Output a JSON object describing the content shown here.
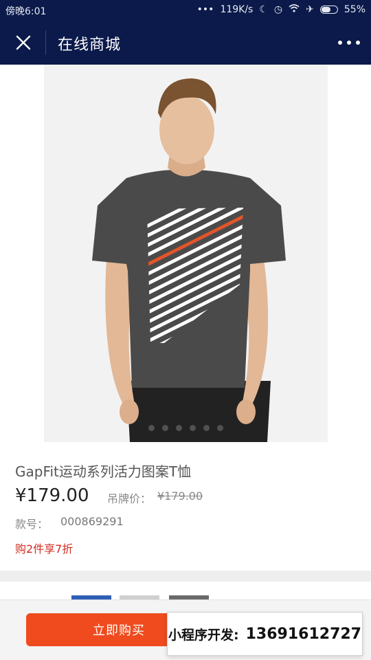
{
  "status_bar": {
    "time": "傍晚6:01",
    "dots": "•••",
    "speed": "119K/s",
    "icons": [
      "moon-icon",
      "alarm-icon",
      "wifi-icon",
      "airplane-icon"
    ],
    "battery": "55%"
  },
  "nav": {
    "title": "在线商城"
  },
  "product": {
    "title": "GapFit运动系列活力图案T恤",
    "price": "¥179.00",
    "orig_label": "吊牌价：",
    "orig_price": "¥179.00",
    "sku_label": "款号：",
    "sku_value": "000869291",
    "promo": "购2件享7折",
    "carousel_count": 7,
    "carousel_active": 0
  },
  "swatch_colors": [
    "#2f5fb4",
    "#d0d0d0",
    "#6a6a6a"
  ],
  "actions": {
    "buy_label": "立即购买"
  },
  "watermark": {
    "label": "小程序开发:",
    "phone": "13691612727"
  },
  "colors": {
    "nav_bg": "#0b1a4a",
    "buy_button": "#ef4b1e",
    "promo_text": "#d42a1f"
  }
}
